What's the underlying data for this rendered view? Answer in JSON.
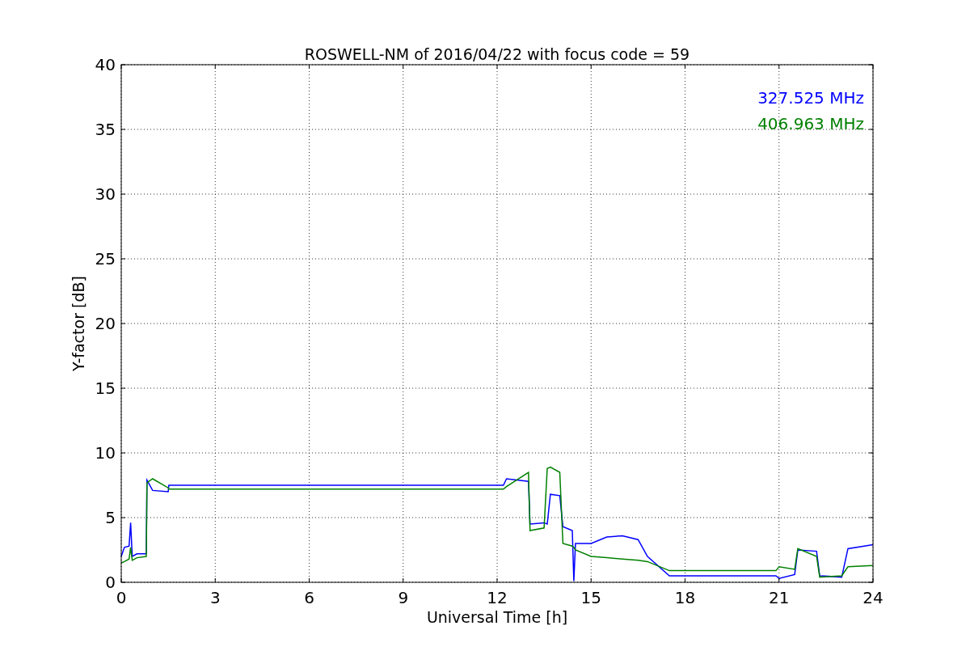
{
  "figure": {
    "chart_data": {
      "type": "line",
      "title": "ROSWELL-NM of 2016/04/22 with focus code = 59",
      "xlabel": "Universal Time [h]",
      "ylabel": "Y-factor [dB]",
      "xlim": [
        0,
        24
      ],
      "ylim": [
        0,
        40
      ],
      "xticks": [
        0,
        3,
        6,
        9,
        12,
        15,
        18,
        21,
        24
      ],
      "yticks": [
        0,
        5,
        10,
        15,
        20,
        25,
        30,
        35,
        40
      ],
      "grid": true,
      "x": [
        0,
        0.1,
        0.25,
        0.3,
        0.35,
        0.5,
        0.8,
        0.82,
        1.0,
        1.5,
        1.52,
        12.2,
        12.3,
        13.0,
        13.05,
        13.5,
        13.6,
        13.7,
        14.0,
        14.1,
        14.4,
        14.45,
        14.5,
        15.0,
        15.5,
        16.0,
        16.5,
        16.8,
        17.5,
        20.9,
        21.0,
        21.5,
        21.6,
        22.2,
        22.3,
        23.0,
        23.2,
        24
      ],
      "series": [
        {
          "name": "327.525 MHz",
          "color": "#0000ff",
          "values": [
            2.0,
            2.7,
            2.8,
            4.6,
            2.0,
            2.2,
            2.2,
            7.9,
            7.1,
            7.0,
            7.5,
            7.5,
            8.0,
            7.8,
            4.5,
            4.6,
            4.5,
            6.8,
            6.7,
            4.3,
            4.0,
            0.1,
            3.0,
            3.0,
            3.5,
            3.6,
            3.3,
            2.0,
            0.5,
            0.5,
            0.3,
            0.6,
            2.5,
            2.4,
            0.5,
            0.4,
            2.6,
            2.9
          ]
        },
        {
          "name": "406.963 MHz",
          "color": "#008000",
          "values": [
            1.5,
            1.6,
            1.8,
            2.7,
            1.7,
            1.9,
            2.0,
            7.7,
            8.0,
            7.3,
            7.2,
            7.2,
            7.4,
            8.5,
            4.0,
            4.2,
            8.8,
            8.9,
            8.5,
            3.0,
            2.8,
            2.7,
            2.5,
            2.0,
            1.9,
            1.8,
            1.7,
            1.6,
            0.9,
            0.9,
            1.2,
            1.0,
            2.6,
            2.0,
            0.4,
            0.5,
            1.2,
            1.3
          ]
        }
      ]
    }
  }
}
